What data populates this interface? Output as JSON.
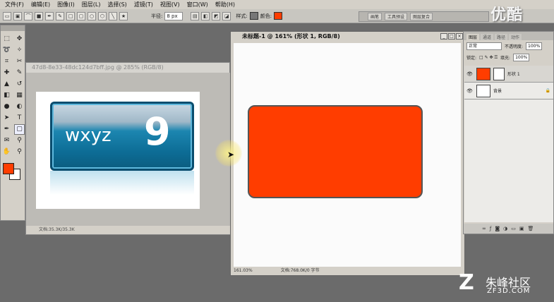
{
  "menubar": {
    "items": [
      "文件(F)",
      "编辑(E)",
      "图像(I)",
      "图层(L)",
      "选择(S)",
      "滤镜(T)",
      "视图(V)",
      "窗口(W)",
      "帮助(H)"
    ]
  },
  "options_bar": {
    "radius_label": "半径:",
    "radius_value": "8 px",
    "style_label": "样式:",
    "color_label": "颜色:",
    "shape_color": "#ff3d00"
  },
  "panel_well": {
    "items": [
      "画笔",
      "工具预设",
      "图层复合"
    ]
  },
  "watermark_top": "优酷",
  "toolbox": {
    "tools": [
      "marquee-icon",
      "move-icon",
      "lasso-icon",
      "magic-wand-icon",
      "crop-icon",
      "slice-icon",
      "healing-icon",
      "brush-icon",
      "stamp-icon",
      "history-brush-icon",
      "eraser-icon",
      "gradient-icon",
      "blur-icon",
      "dodge-icon",
      "path-select-icon",
      "type-icon",
      "pen-icon",
      "shape-icon",
      "notes-icon",
      "eyedropper-icon",
      "hand-icon",
      "zoom-icon"
    ],
    "foreground_color": "#ff3d00",
    "background_color": "#ffffff"
  },
  "doc_back": {
    "title": "47d8-8e33-48dc124d7bff.jpg @ 285% (RGB/8)",
    "button_text_small": "wxyz",
    "button_text_big": "9",
    "status": "文档:35.3K/35.3K"
  },
  "doc_front": {
    "title": "未标题-1 @ 161% (形状 1, RGB/8)",
    "zoom": "161.03%",
    "status": "文档:768.0K/0 字节"
  },
  "layers_panel": {
    "tabs": [
      "图层",
      "通道",
      "路径",
      "动作"
    ],
    "blend_mode": "正常",
    "opacity_label": "不透明度:",
    "opacity": "100%",
    "lock_label": "锁定:",
    "fill_label": "填充:",
    "fill": "100%",
    "layers": [
      {
        "name": "形状 1",
        "color": "#ff3d00",
        "selected": true
      },
      {
        "name": "背景",
        "color": "#ffffff",
        "selected": false
      }
    ]
  },
  "watermark_bottom": {
    "logo": "Z",
    "name": "朱峰社区",
    "domain": "ZF3D.COM"
  }
}
